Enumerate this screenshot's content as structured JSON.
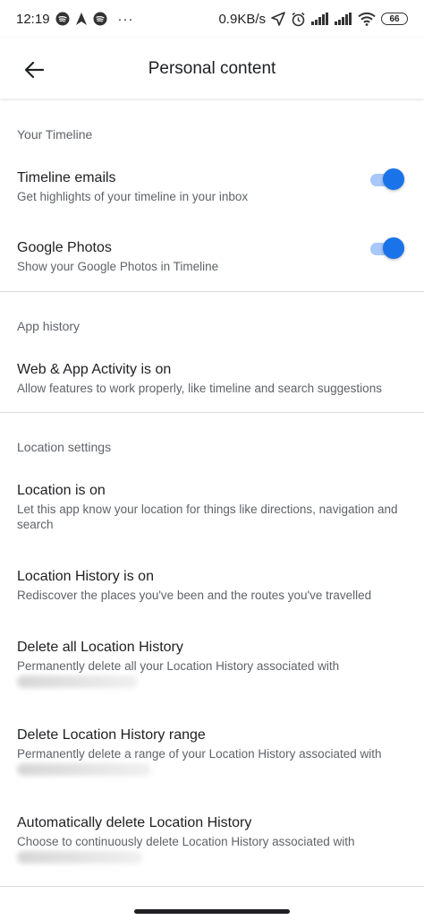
{
  "status_bar": {
    "time": "12:19",
    "dots": "···",
    "network_speed": "0.9KB/s",
    "battery": "66",
    "icons": [
      "spotify-icon",
      "navigation-icon",
      "spotify-icon",
      "location-arrow-icon",
      "alarm-icon",
      "signal-icon",
      "signal-icon",
      "wifi-icon",
      "battery-icon"
    ]
  },
  "app_bar": {
    "title": "Personal content",
    "back_icon": "arrow-left-icon"
  },
  "sections": {
    "timeline": {
      "header": "Your Timeline",
      "timeline_emails": {
        "title": "Timeline emails",
        "subtitle": "Get highlights of your timeline in your inbox",
        "enabled": true
      },
      "google_photos": {
        "title": "Google Photos",
        "subtitle": "Show your Google Photos in Timeline",
        "enabled": true
      }
    },
    "app_history": {
      "header": "App history",
      "web_app_activity": {
        "title": "Web & App Activity is on",
        "subtitle": "Allow features to work properly, like timeline and search suggestions"
      }
    },
    "location": {
      "header": "Location settings",
      "location_on": {
        "title": "Location is on",
        "subtitle": "Let this app know your location for things like directions, navigation and search"
      },
      "location_history": {
        "title": "Location History is on",
        "subtitle": "Rediscover the places you've been and the routes you've travelled"
      },
      "delete_all": {
        "title": "Delete all Location History",
        "subtitle": "Permanently delete all your Location History associated with"
      },
      "delete_range": {
        "title": "Delete Location History range",
        "subtitle": "Permanently delete a range of your Location History associated with"
      },
      "auto_delete": {
        "title": "Automatically delete Location History",
        "subtitle": "Choose to continuously delete Location History associated with"
      }
    }
  },
  "colors": {
    "accent": "#1a73e8",
    "toggle_track": "#a8c7fa",
    "divider": "#dadce0",
    "secondary_text": "#5f6368"
  }
}
